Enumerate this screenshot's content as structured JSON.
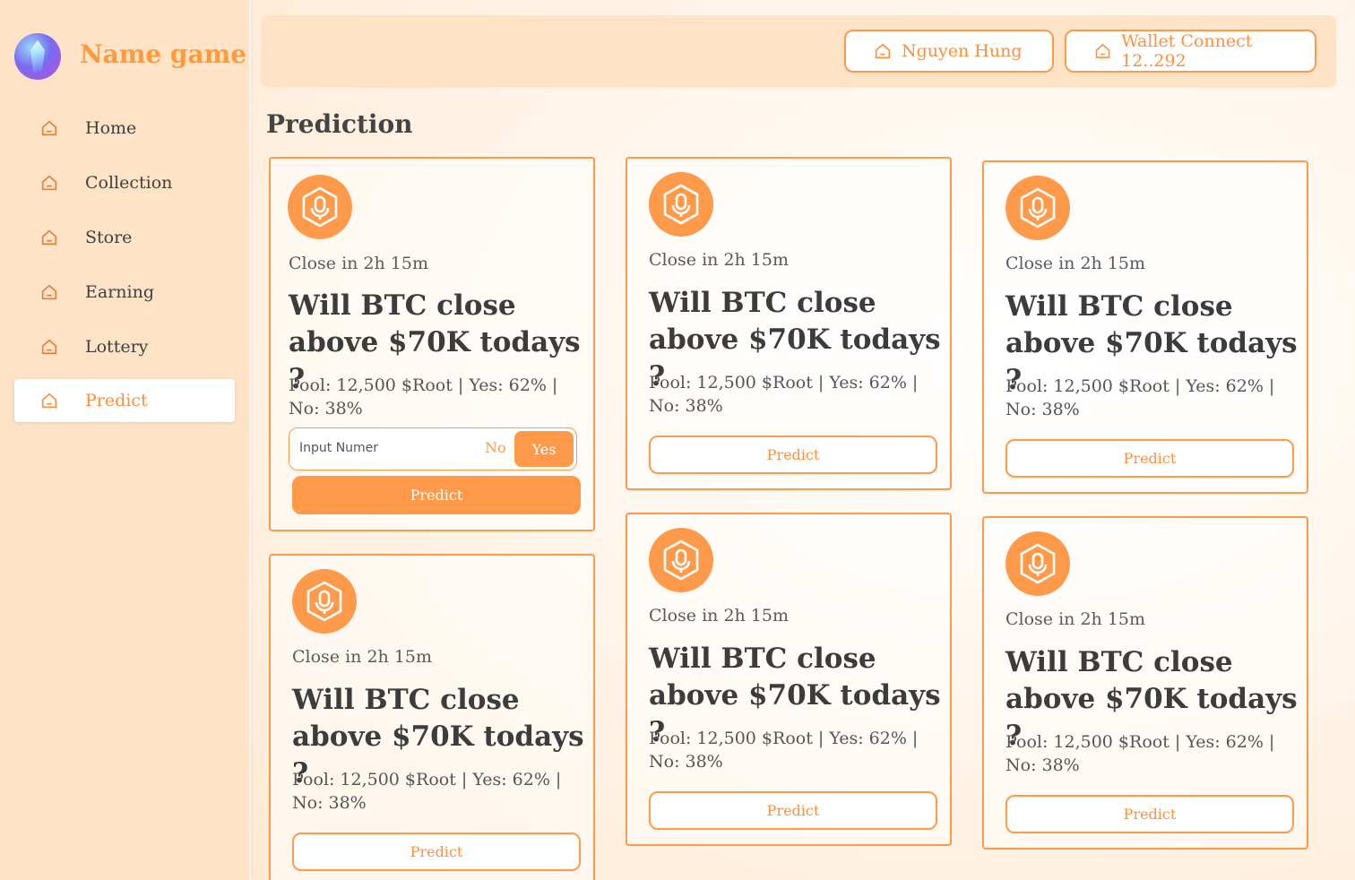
{
  "brand": {
    "name": "Name game"
  },
  "sidebar": {
    "items": [
      {
        "label": "Home",
        "icon": "home-icon"
      },
      {
        "label": "Collection",
        "icon": "home-icon"
      },
      {
        "label": "Store",
        "icon": "home-icon"
      },
      {
        "label": "Earning",
        "icon": "home-icon"
      },
      {
        "label": "Lottery",
        "icon": "home-icon"
      },
      {
        "label": "Predict",
        "icon": "home-icon",
        "active": true
      }
    ]
  },
  "header": {
    "user_label": "Nguyen Hung",
    "wallet_label": "Wallet Connect 12..292"
  },
  "page": {
    "title": "Prediction"
  },
  "cards": [
    {
      "close": "Close in 2h 15m",
      "question": "Will BTC close above $70K todays ?",
      "pool": "Pool: 12,500 $Root | Yes: 62% | No: 38%",
      "input_placeholder": "Input Numer",
      "no_label": "No",
      "yes_label": "Yes",
      "predict_label": "Predict"
    },
    {
      "close": "Close in 2h 15m",
      "question": "Will BTC close above $70K todays ?",
      "pool": "Pool: 12,500 $Root | Yes: 62% | No: 38%",
      "predict_label": "Predict"
    },
    {
      "close": "Close in 2h 15m",
      "question": "Will BTC close above $70K todays ?",
      "pool": "Pool: 12,500 $Root | Yes: 62% | No: 38%",
      "predict_label": "Predict"
    },
    {
      "close": "Close in 2h 15m",
      "question": "Will BTC close above $70K todays ?",
      "pool": "Pool: 12,500 $Root | Yes: 62% | No: 38%",
      "predict_label": "Predict"
    },
    {
      "close": "Close in 2h 15m",
      "question": "Will BTC close above $70K todays ?",
      "pool": "Pool: 12,500 $Root | Yes: 62% | No: 38%",
      "predict_label": "Predict"
    },
    {
      "close": "Close in 2h 15m",
      "question": "Will BTC close above $70K todays ?",
      "pool": "Pool: 12,500 $Root | Yes: 62% | No: 38%",
      "predict_label": "Predict"
    }
  ],
  "colors": {
    "accent": "#ff9a4a",
    "sidebar_bg": "#ffe3c7",
    "text": "#3c3c3c"
  }
}
